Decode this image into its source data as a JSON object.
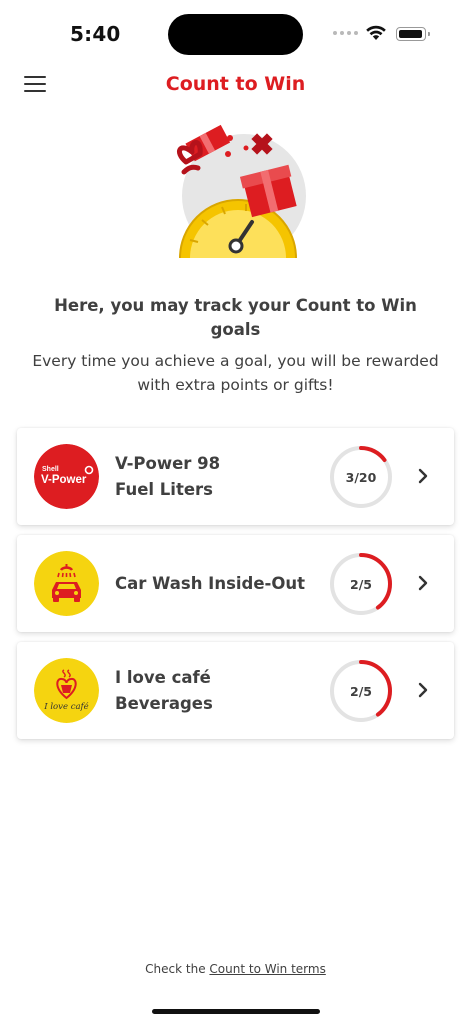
{
  "status": {
    "time": "5:40"
  },
  "header": {
    "title": "Count to Win"
  },
  "intro": {
    "heading": "Here, you may track your Count to Win goals",
    "text": "Every time you achieve a goal, you will be rewarded with extra points or gifts!"
  },
  "goals": [
    {
      "title": "V-Power 98\nFuel Liters",
      "progress_label": "3/20",
      "progress": 0.15,
      "icon": "vpower-logo-icon",
      "logo_small": "Shell",
      "logo_big": "V-Power"
    },
    {
      "title": "Car Wash Inside-Out",
      "progress_label": "2/5",
      "progress": 0.4,
      "icon": "car-wash-icon"
    },
    {
      "title": "I love café\nBeverages",
      "progress_label": "2/5",
      "progress": 0.4,
      "icon": "cafe-cup-icon",
      "logo_text": "I love café"
    }
  ],
  "footer": {
    "terms_prefix": "Check the",
    "terms_link": "Count to Win terms"
  },
  "colors": {
    "brand_red": "#dd1d21",
    "brand_yellow": "#f5d410",
    "track_gray": "#e3e3e3"
  }
}
